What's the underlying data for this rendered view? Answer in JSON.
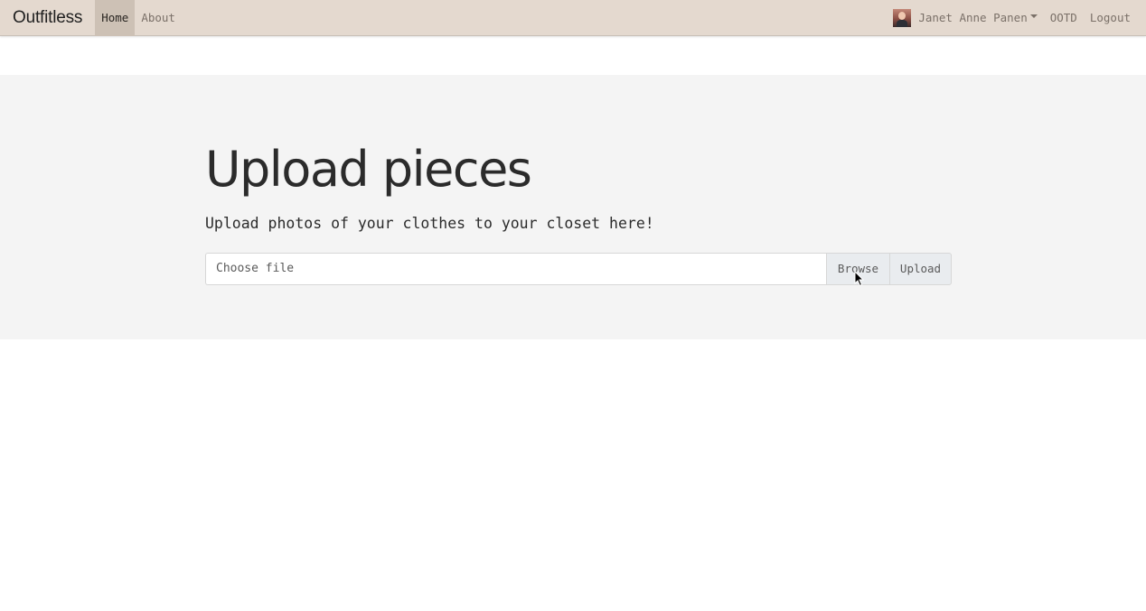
{
  "navbar": {
    "brand": "Outfitless",
    "links": [
      {
        "label": "Home",
        "active": true
      },
      {
        "label": "About",
        "active": false
      }
    ],
    "user": {
      "name": "Janet Anne Panen"
    },
    "right_links": [
      {
        "label": "OOTD"
      },
      {
        "label": "Logout"
      }
    ]
  },
  "main": {
    "title": "Upload pieces",
    "subtitle": "Upload photos of your clothes to your closet here!",
    "file_input": {
      "placeholder": "Choose file",
      "browse_label": "Browse"
    },
    "upload_label": "Upload"
  },
  "colors": {
    "navbar_bg": "#e4d9cf",
    "nav_active_bg": "#cdc1b5",
    "jumbotron_bg": "#f4f4f4",
    "button_bg": "#e9ecef"
  },
  "icons": {
    "user_menu_caret": "caret-down-icon",
    "cursor": "mouse-pointer-icon"
  }
}
